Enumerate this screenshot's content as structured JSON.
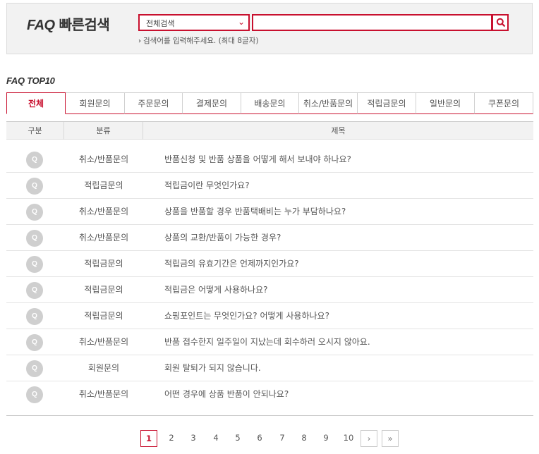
{
  "search": {
    "title_prefix": "FAQ",
    "title_main": "빠른검색",
    "select_value": "전체검색",
    "input_value": "",
    "hint": "검색어를 입력해주세요. (최대 8글자)"
  },
  "top10": {
    "title": "FAQ TOP10",
    "tabs": [
      "전체",
      "회원문의",
      "주문문의",
      "결제문의",
      "배송문의",
      "취소/반품문의",
      "적립금문의",
      "일반문의",
      "쿠폰문의"
    ],
    "active_tab": "전체"
  },
  "table": {
    "headers": [
      "구분",
      "분류",
      "제목"
    ],
    "badge": "Q",
    "rows": [
      {
        "category": "취소/반품문의",
        "subject": "반품신청 및 반품 상품을 어떻게 해서 보내야 하나요?"
      },
      {
        "category": "적립금문의",
        "subject": "적립금이란 무엇인가요?"
      },
      {
        "category": "취소/반품문의",
        "subject": "상품을 반품할 경우 반품택배비는 누가 부담하나요?"
      },
      {
        "category": "취소/반품문의",
        "subject": "상품의 교환/반품이 가능한 경우?"
      },
      {
        "category": "적립금문의",
        "subject": "적립금의 유효기간은 언제까지인가요?"
      },
      {
        "category": "적립금문의",
        "subject": "적립금은 어떻게 사용하나요?"
      },
      {
        "category": "적립금문의",
        "subject": "쇼핑포인트는 무엇인가요? 어떻게 사용하나요?"
      },
      {
        "category": "취소/반품문의",
        "subject": "반품 접수한지 일주일이 지났는데 회수하러 오시지 않아요."
      },
      {
        "category": "회원문의",
        "subject": "회원 탈퇴가 되지 않습니다."
      },
      {
        "category": "취소/반품문의",
        "subject": "어떤 경우에 상품 반품이 안되나요?"
      }
    ]
  },
  "pagination": {
    "pages": [
      "1",
      "2",
      "3",
      "4",
      "5",
      "6",
      "7",
      "8",
      "9",
      "10"
    ],
    "current": "1",
    "next_label": "›",
    "last_label": "»"
  },
  "colors": {
    "accent": "#c8102e",
    "badge": "#cfcfcf",
    "header_bg": "#f2f2f2"
  }
}
